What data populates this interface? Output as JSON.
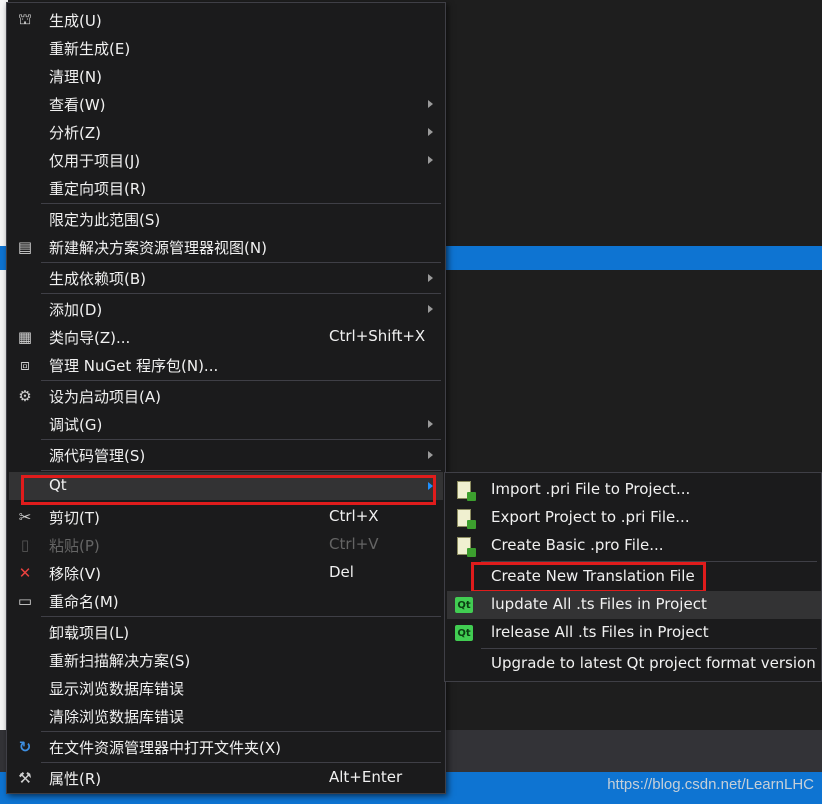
{
  "menu": {
    "items": [
      {
        "label": "生成(U)",
        "icon": "build-icon",
        "glyph": "⛫"
      },
      {
        "label": "重新生成(E)"
      },
      {
        "label": "清理(N)"
      },
      {
        "label": "查看(W)",
        "submenu": true
      },
      {
        "label": "分析(Z)",
        "submenu": true
      },
      {
        "label": "仅用于项目(J)",
        "submenu": true
      },
      {
        "label": "重定向项目(R)"
      },
      {
        "label": "限定为此范围(S)"
      },
      {
        "label": "新建解决方案资源管理器视图(N)",
        "icon": "new-view-icon",
        "glyph": "▤"
      },
      {
        "label": "生成依赖项(B)",
        "submenu": true
      },
      {
        "label": "添加(D)",
        "submenu": true
      },
      {
        "label": "类向导(Z)...",
        "icon": "class-wizard-icon",
        "glyph": "▦",
        "shortcut": "Ctrl+Shift+X"
      },
      {
        "label": "管理 NuGet 程序包(N)...",
        "icon": "nuget-icon",
        "glyph": "⧈"
      },
      {
        "label": "设为启动项目(A)",
        "icon": "gear-icon",
        "glyph": "⚙"
      },
      {
        "label": "调试(G)",
        "submenu": true
      },
      {
        "label": "源代码管理(S)",
        "submenu": true
      },
      {
        "label": "Qt",
        "submenu": true
      },
      {
        "label": "剪切(T)",
        "icon": "scissors-icon",
        "glyph": "✂",
        "shortcut": "Ctrl+X"
      },
      {
        "label": "粘贴(P)",
        "icon": "paste-icon",
        "glyph": "📋",
        "shortcut": "Ctrl+V",
        "disabled": true
      },
      {
        "label": "移除(V)",
        "icon": "remove-icon",
        "glyph": "✕",
        "shortcut": "Del"
      },
      {
        "label": "重命名(M)",
        "icon": "rename-icon",
        "glyph": "▭"
      },
      {
        "label": "卸载项目(L)"
      },
      {
        "label": "重新扫描解决方案(S)"
      },
      {
        "label": "显示浏览数据库错误"
      },
      {
        "label": "清除浏览数据库错误"
      },
      {
        "label": "在文件资源管理器中打开文件夹(X)",
        "icon": "open-folder-icon",
        "glyph": "↻"
      },
      {
        "label": "属性(R)",
        "icon": "wrench-icon",
        "glyph": "🔧",
        "shortcut": "Alt+Enter"
      }
    ]
  },
  "submenu": {
    "items": [
      {
        "label": "Import .pri File to Project..."
      },
      {
        "label": "Export Project to .pri File..."
      },
      {
        "label": "Create Basic .pro File..."
      },
      {
        "label": "Create New Translation File"
      },
      {
        "label": "lupdate All .ts Files in Project",
        "qt_logo": "Qt"
      },
      {
        "label": "lrelease All .ts Files in Project",
        "qt_logo": "Qt"
      },
      {
        "label": "Upgrade to latest Qt project format version"
      }
    ]
  },
  "watermark": "https://blog.csdn.net/LearnLHC",
  "colors": {
    "menu_bg": "#1b1b1c",
    "highlight": "#333334",
    "accent": "#0e74d2",
    "annotation_red": "#e01c1c"
  }
}
